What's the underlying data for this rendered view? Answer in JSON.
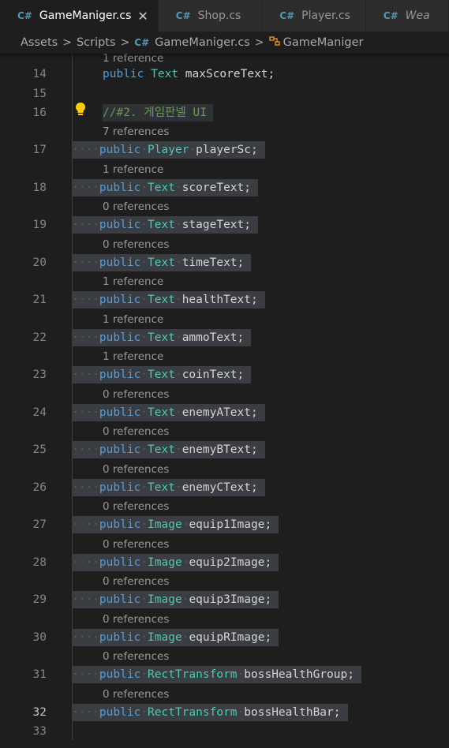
{
  "tabs": [
    {
      "icon": "C#",
      "label": "GameManiger.cs",
      "close": "✕",
      "active": true
    },
    {
      "icon": "C#",
      "label": "Shop.cs",
      "active": false
    },
    {
      "icon": "C#",
      "label": "Player.cs",
      "active": false
    },
    {
      "icon": "C#",
      "label": "Wea",
      "active": false
    }
  ],
  "breadcrumb": {
    "items": [
      "Assets",
      "Scripts",
      "GameManiger.cs",
      "GameManiger"
    ],
    "separator": ">",
    "file_icon": "C#",
    "class_icon": "class-icon"
  },
  "editor": {
    "top_codelens": "1 reference",
    "lines": [
      {
        "num": "14",
        "codelens": "",
        "kw": "public",
        "type": "Text",
        "ident": "maxScoreText;",
        "selected": false
      },
      {
        "num": "15",
        "blank": true
      },
      {
        "num": "16",
        "comment": "//#2. 게임판넬 UI",
        "lightbulb": true
      },
      {
        "num": "17",
        "codelens": "7 references",
        "kw": "public",
        "type": "Player",
        "ident": "playerSc;",
        "selected": true
      },
      {
        "num": "18",
        "codelens": "1 reference",
        "kw": "public",
        "type": "Text",
        "ident": "scoreText;",
        "selected": true
      },
      {
        "num": "19",
        "codelens": "0 references",
        "kw": "public",
        "type": "Text",
        "ident": "stageText;",
        "selected": true
      },
      {
        "num": "20",
        "codelens": "0 references",
        "kw": "public",
        "type": "Text",
        "ident": "timeText;",
        "selected": true
      },
      {
        "num": "21",
        "codelens": "1 reference",
        "kw": "public",
        "type": "Text",
        "ident": "healthText;",
        "selected": true
      },
      {
        "num": "22",
        "codelens": "1 reference",
        "kw": "public",
        "type": "Text",
        "ident": "ammoText;",
        "selected": true
      },
      {
        "num": "23",
        "codelens": "1 reference",
        "kw": "public",
        "type": "Text",
        "ident": "coinText;",
        "selected": true
      },
      {
        "num": "24",
        "codelens": "0 references",
        "kw": "public",
        "type": "Text",
        "ident": "enemyAText;",
        "selected": true
      },
      {
        "num": "25",
        "codelens": "0 references",
        "kw": "public",
        "type": "Text",
        "ident": "enemyBText;",
        "selected": true
      },
      {
        "num": "26",
        "codelens": "0 references",
        "kw": "public",
        "type": "Text",
        "ident": "enemyCText;",
        "selected": true
      },
      {
        "num": "27",
        "codelens": "0 references",
        "kw": "public",
        "type": "Image",
        "ident": "equip1Image;",
        "selected": true
      },
      {
        "num": "28",
        "codelens": "0 references",
        "kw": "public",
        "type": "Image",
        "ident": "equip2Image;",
        "selected": true
      },
      {
        "num": "29",
        "codelens": "0 references",
        "kw": "public",
        "type": "Image",
        "ident": "equip3Image;",
        "selected": true
      },
      {
        "num": "30",
        "codelens": "0 references",
        "kw": "public",
        "type": "Image",
        "ident": "equipRImage;",
        "selected": true
      },
      {
        "num": "31",
        "codelens": "0 references",
        "kw": "public",
        "type": "RectTransform",
        "ident": "bossHealthGroup;",
        "selected": true
      },
      {
        "num": "32",
        "codelens": "0 references",
        "kw": "public",
        "type": "RectTransform",
        "ident": "bossHealthBar;",
        "selected": true,
        "current": true
      },
      {
        "num": "33",
        "blank": true
      }
    ]
  },
  "colors": {
    "keyword": "#569cd6",
    "type": "#4ec9b0",
    "comment": "#6a9955",
    "selection": "#3a3d41",
    "background": "#1e1e1e",
    "lightbulb": "#ffcc00"
  }
}
